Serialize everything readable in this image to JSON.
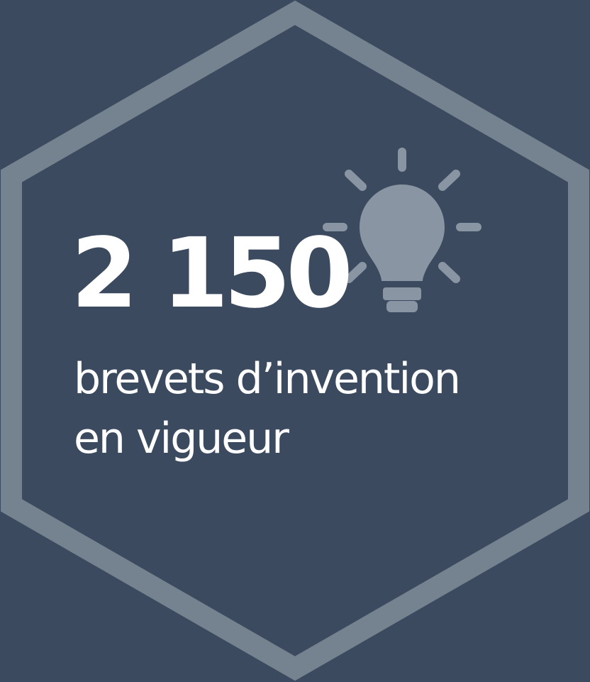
{
  "stat": {
    "value": "2 150",
    "label_line1": "brevets d’invention",
    "label_line2": "en vigueur"
  },
  "icons": [
    "lightbulb-icon",
    "hexagon-frame"
  ],
  "colors": {
    "background": "#3c4a5f",
    "hexagon_border": "#75828f",
    "icon": "#8a95a3",
    "text": "#ffffff"
  }
}
